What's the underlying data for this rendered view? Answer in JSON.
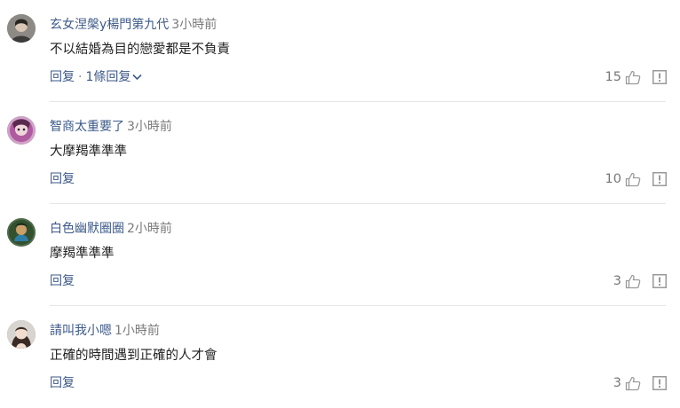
{
  "comments": [
    {
      "author": "玄女涅槃y楊門第九代",
      "time": "3小時前",
      "text": "不以結婚為目的戀愛都是不負責",
      "reply_label": "回复",
      "reply_count_label": "1條回复",
      "likes": "15"
    },
    {
      "author": "智商太重要了",
      "time": "3小時前",
      "text": "大摩羯準準準",
      "reply_label": "回复",
      "likes": "10"
    },
    {
      "author": "白色幽默圈圈",
      "time": "2小時前",
      "text": "摩羯準準準",
      "reply_label": "回复",
      "likes": "3"
    },
    {
      "author": "請叫我小嗯",
      "time": "1小時前",
      "text": "正確的時間遇到正確的人才會",
      "reply_label": "回复",
      "likes": "3"
    }
  ],
  "icons": {
    "like": "thumbs-up-icon",
    "report": "report-icon",
    "expand": "chevron-down-icon"
  },
  "colors": {
    "author": "#3d5a8a",
    "time": "#7a7a7a",
    "icon": "#9a9a9a"
  }
}
